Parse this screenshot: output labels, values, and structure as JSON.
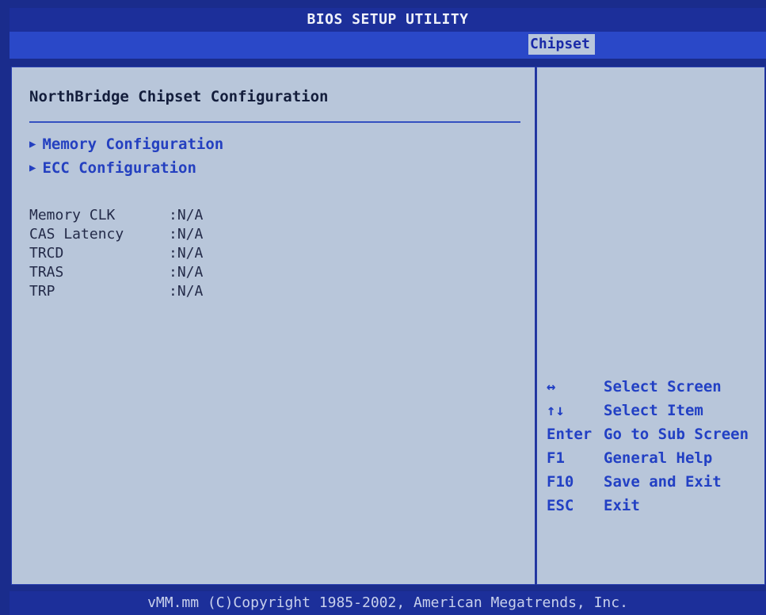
{
  "header": {
    "title": "BIOS SETUP UTILITY"
  },
  "menu": {
    "active_tab": "Chipset"
  },
  "main": {
    "title": "NorthBridge Chipset Configuration",
    "submenus": [
      {
        "label": "Memory Configuration",
        "icon": "triangle-right-icon"
      },
      {
        "label": "ECC Configuration",
        "icon": "triangle-right-icon"
      }
    ],
    "info": [
      {
        "label": "Memory CLK",
        "value": ":N/A"
      },
      {
        "label": "CAS Latency",
        "value": ":N/A"
      },
      {
        "label": "TRCD",
        "value": ":N/A"
      },
      {
        "label": "TRAS",
        "value": ":N/A"
      },
      {
        "label": "TRP",
        "value": ":N/A"
      }
    ]
  },
  "help": [
    {
      "key": "↔",
      "action": "Select Screen"
    },
    {
      "key": "↑↓",
      "action": "Select Item"
    },
    {
      "key": "Enter",
      "action": "Go to Sub Screen"
    },
    {
      "key": "F1",
      "action": "General Help"
    },
    {
      "key": "F10",
      "action": "Save and Exit"
    },
    {
      "key": "ESC",
      "action": "Exit"
    }
  ],
  "footer": {
    "text": "vMM.mm (C)Copyright 1985-2002, American Megatrends, Inc."
  },
  "colors": {
    "frame": "#1a2c8c",
    "menu_bar": "#2a48c8",
    "panel": "#b8c6da",
    "highlight_text": "#2440c0"
  }
}
